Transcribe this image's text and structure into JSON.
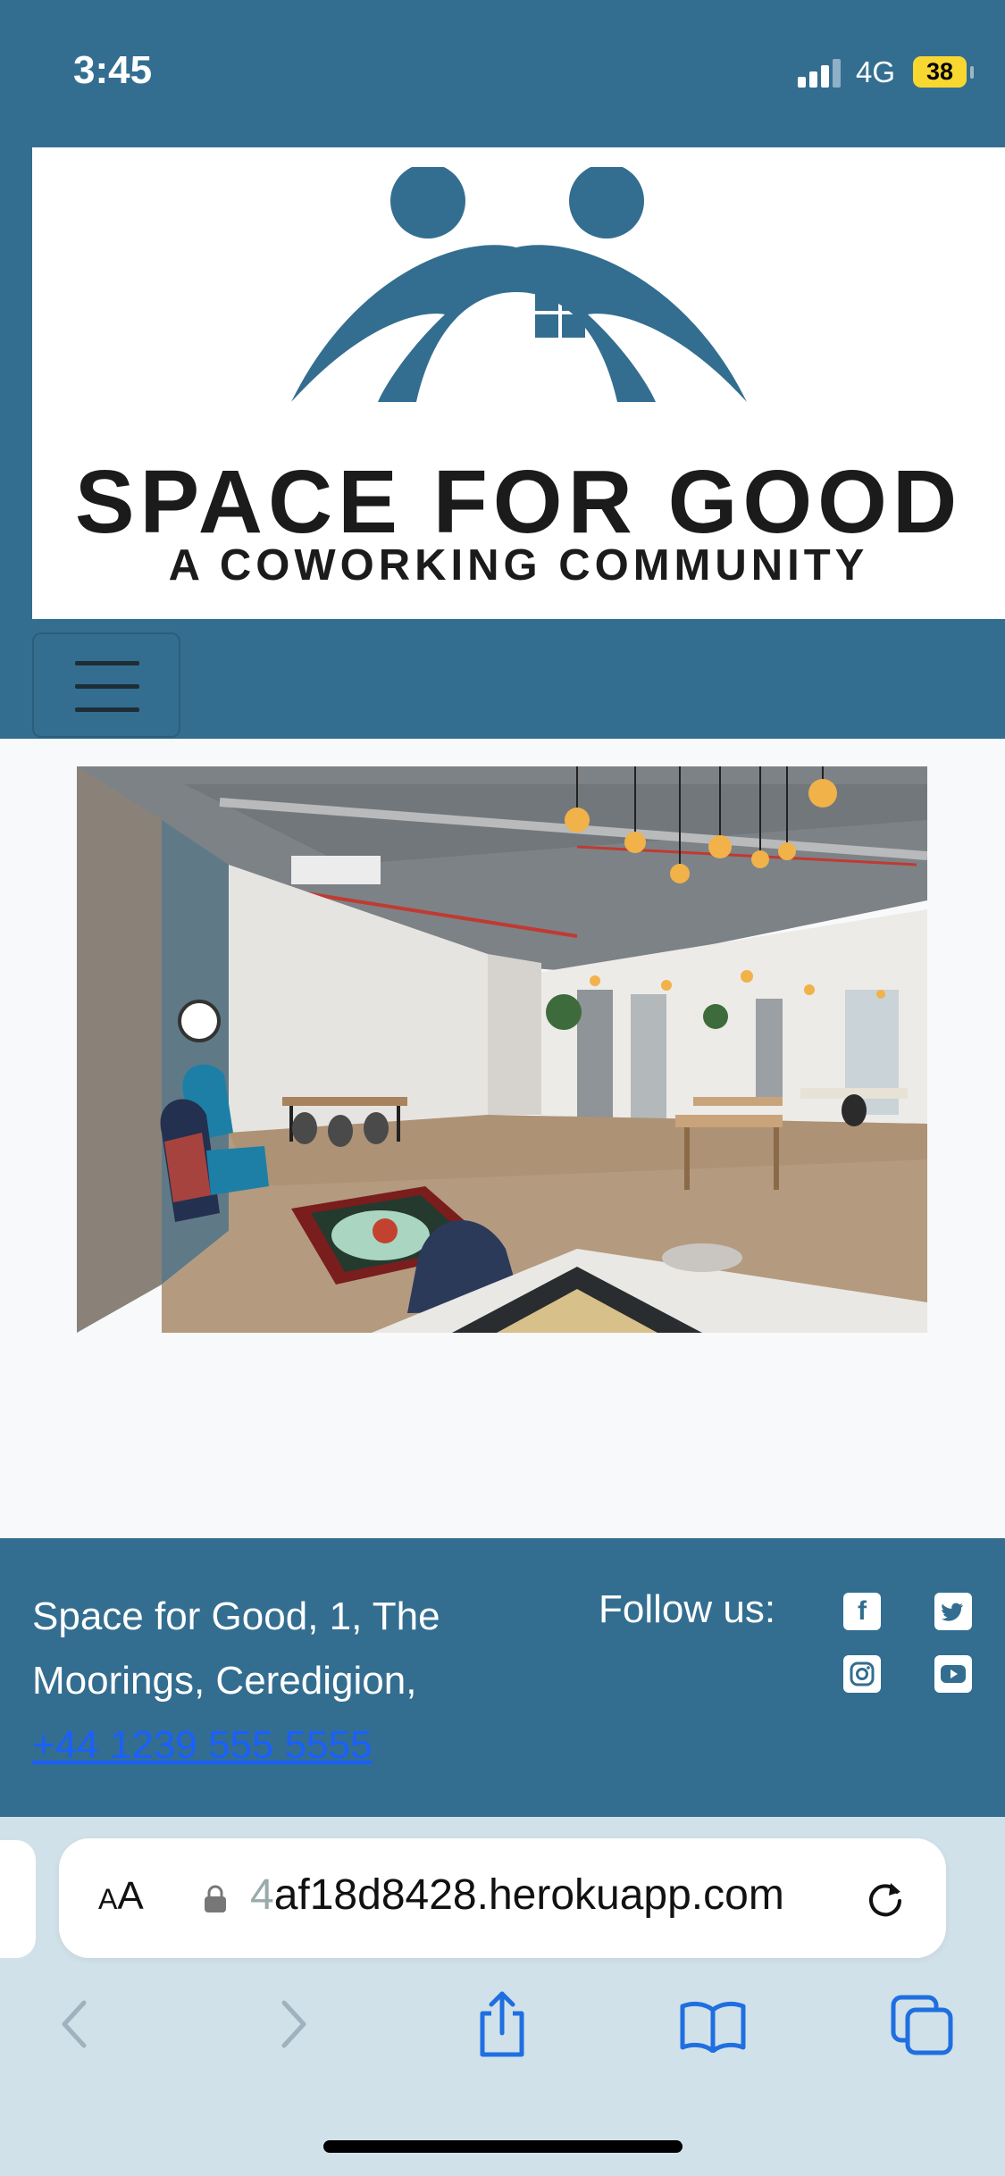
{
  "status_bar": {
    "time": "3:45",
    "network": "4G",
    "battery": "38"
  },
  "header": {
    "brand_title": "SPACE FOR GOOD",
    "brand_subtitle": "A COWORKING COMMUNITY",
    "menu_toggle": "menu-icon"
  },
  "footer": {
    "address_line": "Space for Good, 1, The Moorings, Ceredigion,",
    "phone": "+44 1239 555 5555",
    "follow_label": "Follow us:",
    "social": [
      "facebook-icon",
      "twitter-icon",
      "instagram-icon",
      "youtube-icon"
    ]
  },
  "browser": {
    "aa_label_small": "A",
    "aa_label": "A",
    "url_dim": "4",
    "url": "af18d8428.herokuapp.com"
  },
  "colors": {
    "brand": "#336e90",
    "link": "#1a5fff",
    "page_bg": "#f8f9fa",
    "chrome_bg": "#d1e1ea"
  }
}
